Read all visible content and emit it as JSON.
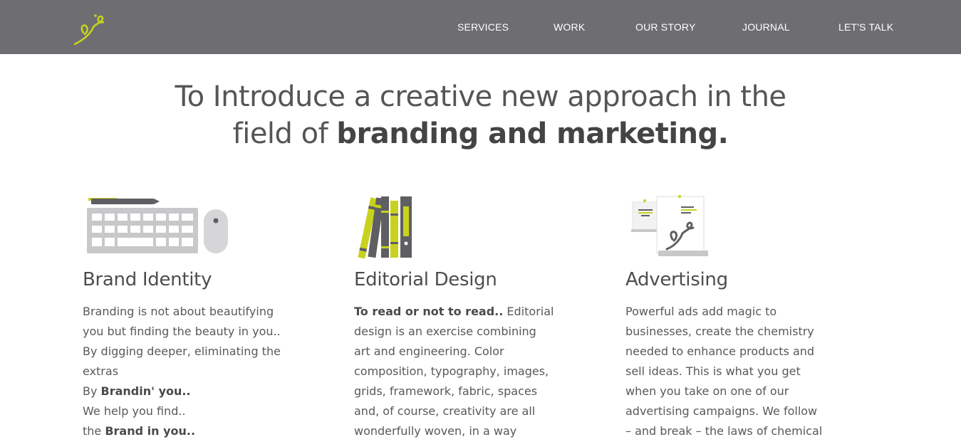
{
  "header": {
    "logo_icon": "brand-calligraphy-logo",
    "nav": [
      {
        "label": "SERVICES"
      },
      {
        "label": "WORK"
      },
      {
        "label": "OUR STORY"
      },
      {
        "label": "JOURNAL"
      },
      {
        "label": "LET'S TALK"
      }
    ]
  },
  "hero": {
    "line1": "To Introduce a creative new approach in the",
    "line2_prefix": "field of ",
    "line2_bold": "branding and marketing."
  },
  "services": [
    {
      "icon": "keyboard-mouse-pen-icon",
      "title": "Brand Identity",
      "lines": [
        {
          "text": "Branding is not about beautifying"
        },
        {
          "text": "you but finding the beauty in you.."
        },
        {
          "text": "By digging deeper, eliminating the"
        },
        {
          "text": "extras"
        },
        {
          "prefix": "By ",
          "bold": "Brandin' you.."
        },
        {
          "text": "We help you find.."
        },
        {
          "prefix": "the ",
          "bold": "Brand in you.."
        }
      ]
    },
    {
      "icon": "books-binders-icon",
      "title": "Editorial Design",
      "lines": [
        {
          "bold": "To read or not to read..",
          "suffix": " Editorial"
        },
        {
          "text": "design is an exercise combining"
        },
        {
          "text": "art and engineering. Color"
        },
        {
          "text": "composition, typography, images,"
        },
        {
          "text": "grids, framework, fabric, spaces"
        },
        {
          "text": "and, of course, creativity are all"
        },
        {
          "text": "wonderfully woven, in a way"
        }
      ]
    },
    {
      "icon": "posters-ads-icon",
      "title": "Advertising",
      "lines": [
        {
          "text": "Powerful ads add magic to"
        },
        {
          "text": "businesses, create the chemistry"
        },
        {
          "text": "needed to enhance products and"
        },
        {
          "text": "sell ideas. This is what you get"
        },
        {
          "text": "when you take on one of our"
        },
        {
          "text": "advertising campaigns. We follow"
        },
        {
          "text": "– and break – the laws of chemical"
        }
      ]
    }
  ],
  "colors": {
    "header_bg": "#6e6d72",
    "accent_yellow": "#c8d21e",
    "icon_grey": "#c8c8cb",
    "dark_grey": "#5f5f63"
  }
}
